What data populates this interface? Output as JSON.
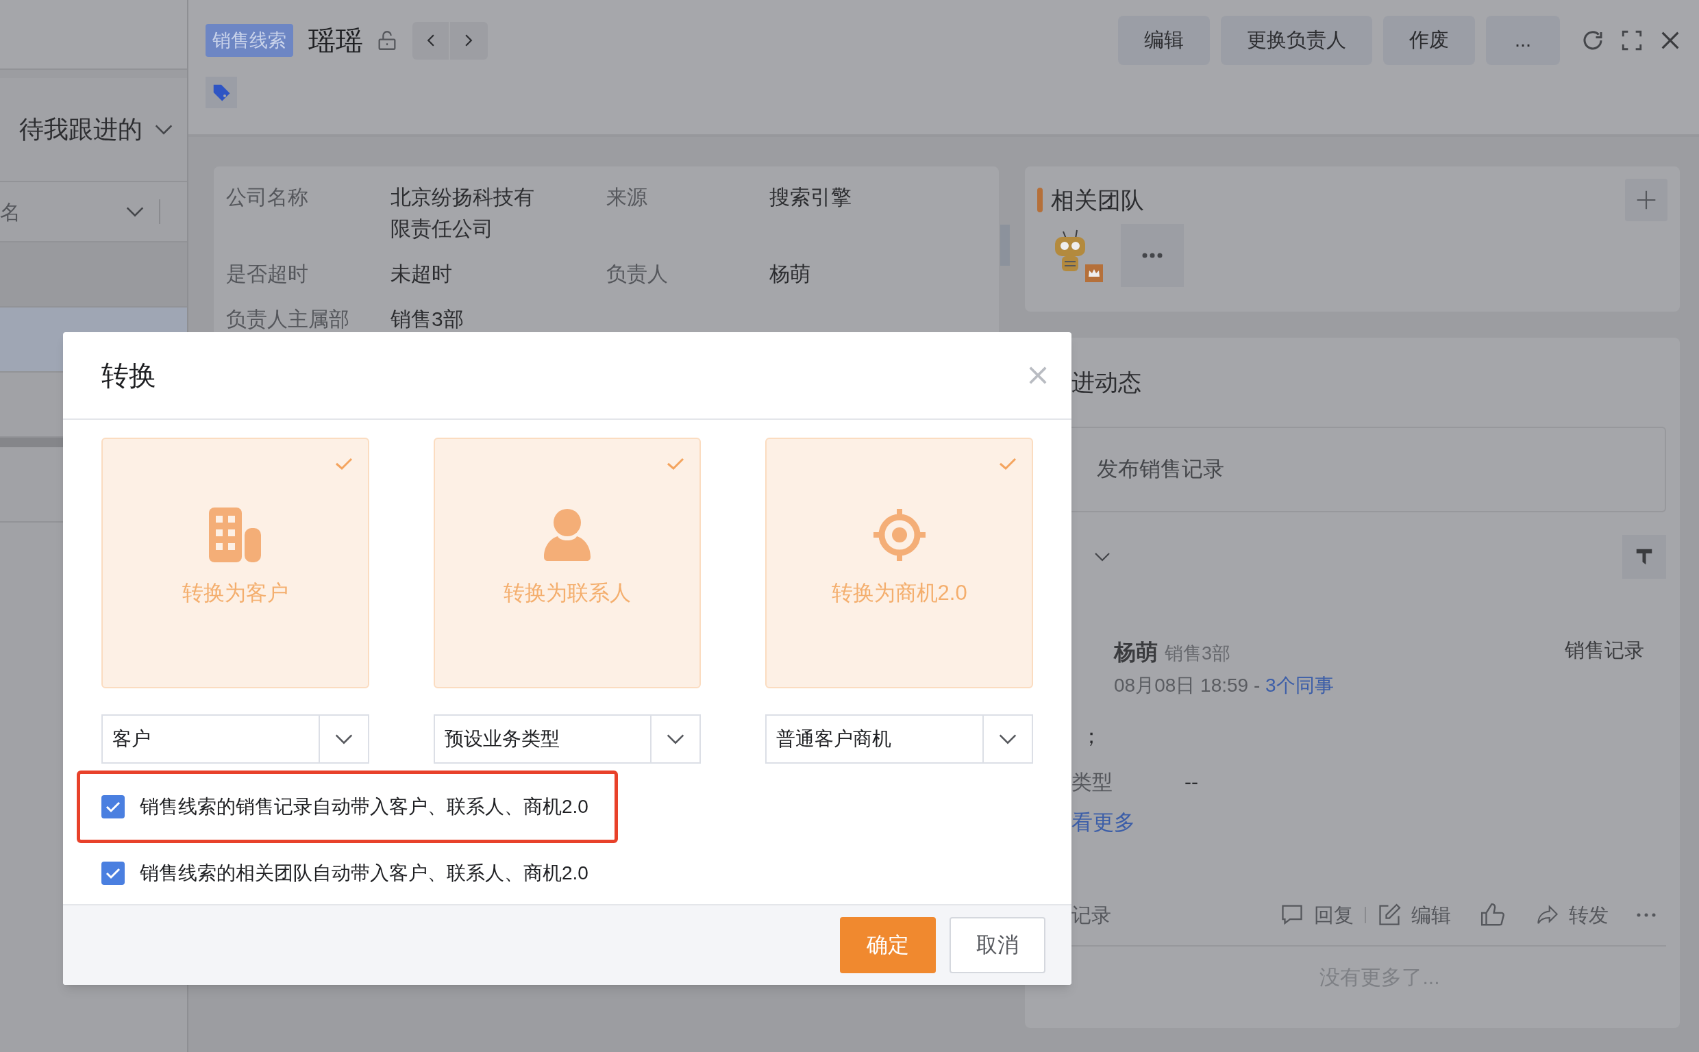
{
  "sidebar": {
    "filter": "待我跟进的",
    "column_field": "名"
  },
  "header": {
    "tag": "销售线索",
    "title": "瑶瑶",
    "actions": [
      "编辑",
      "更换负责人",
      "作废",
      "..."
    ]
  },
  "info": {
    "fields": [
      {
        "label": "公司名称",
        "value": "北京纷扬科技有限责任公司"
      },
      {
        "label": "来源",
        "value": "搜索引擎"
      },
      {
        "label": "是否超时",
        "value": "未超时"
      },
      {
        "label": "负责人",
        "value": "杨萌"
      },
      {
        "label": "负责人主属部",
        "value": "销售3部"
      }
    ]
  },
  "team": {
    "title": "相关团队"
  },
  "follow": {
    "title": "进动态",
    "publish_placeholder": "发布销售记录",
    "post": {
      "author": "杨萌",
      "dept": "销售3部",
      "type": "销售记录",
      "time": "08月08日 18:59 - ",
      "colleagues": "3个同事",
      "content": "；",
      "field_label": "类型",
      "field_value": "--",
      "more": "看更多",
      "footer_label": "记录",
      "actions": [
        "回复",
        "编辑",
        "转发"
      ]
    },
    "end": "没有更多了..."
  },
  "dialog": {
    "title": "转换",
    "cards": [
      {
        "kind": "building",
        "label": "转换为客户",
        "selected": true
      },
      {
        "kind": "person",
        "label": "转换为联系人",
        "selected": true
      },
      {
        "kind": "target",
        "label": "转换为商机2.0",
        "selected": true
      }
    ],
    "selects": [
      "客户",
      "预设业务类型",
      "普通客户商机"
    ],
    "options": [
      {
        "label": "销售线索的销售记录自动带入客户、联系人、商机2.0",
        "checked": true,
        "highlighted": true
      },
      {
        "label": "销售线索的相关团队自动带入客户、联系人、商机2.0",
        "checked": true,
        "highlighted": false
      }
    ],
    "buttons": [
      "确定",
      "取消"
    ]
  }
}
